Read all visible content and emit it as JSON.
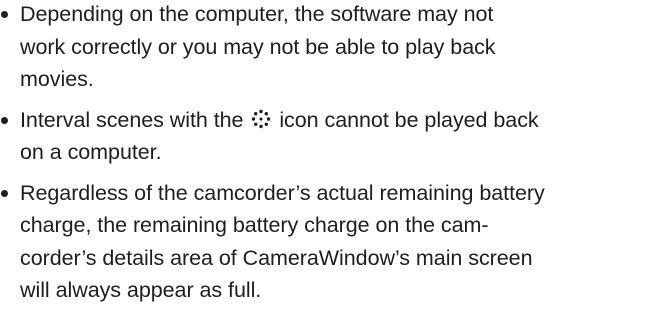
{
  "notes": [
    {
      "lines": [
        "Depending on the computer, the software may not",
        "work correctly or you may not be able to play back",
        "movies."
      ]
    },
    {
      "line1_before_icon": "Interval scenes with the ",
      "icon": "interval-scene-icon",
      "line1_after_icon": " icon cannot be played back",
      "line2": "on a computer."
    },
    {
      "lines": [
        "Regardless of the camcorder’s actual remaining battery",
        "charge, the remaining battery charge on the cam-",
        "corder’s details area of CameraWindow’s main screen",
        "will always appear as full."
      ]
    }
  ]
}
